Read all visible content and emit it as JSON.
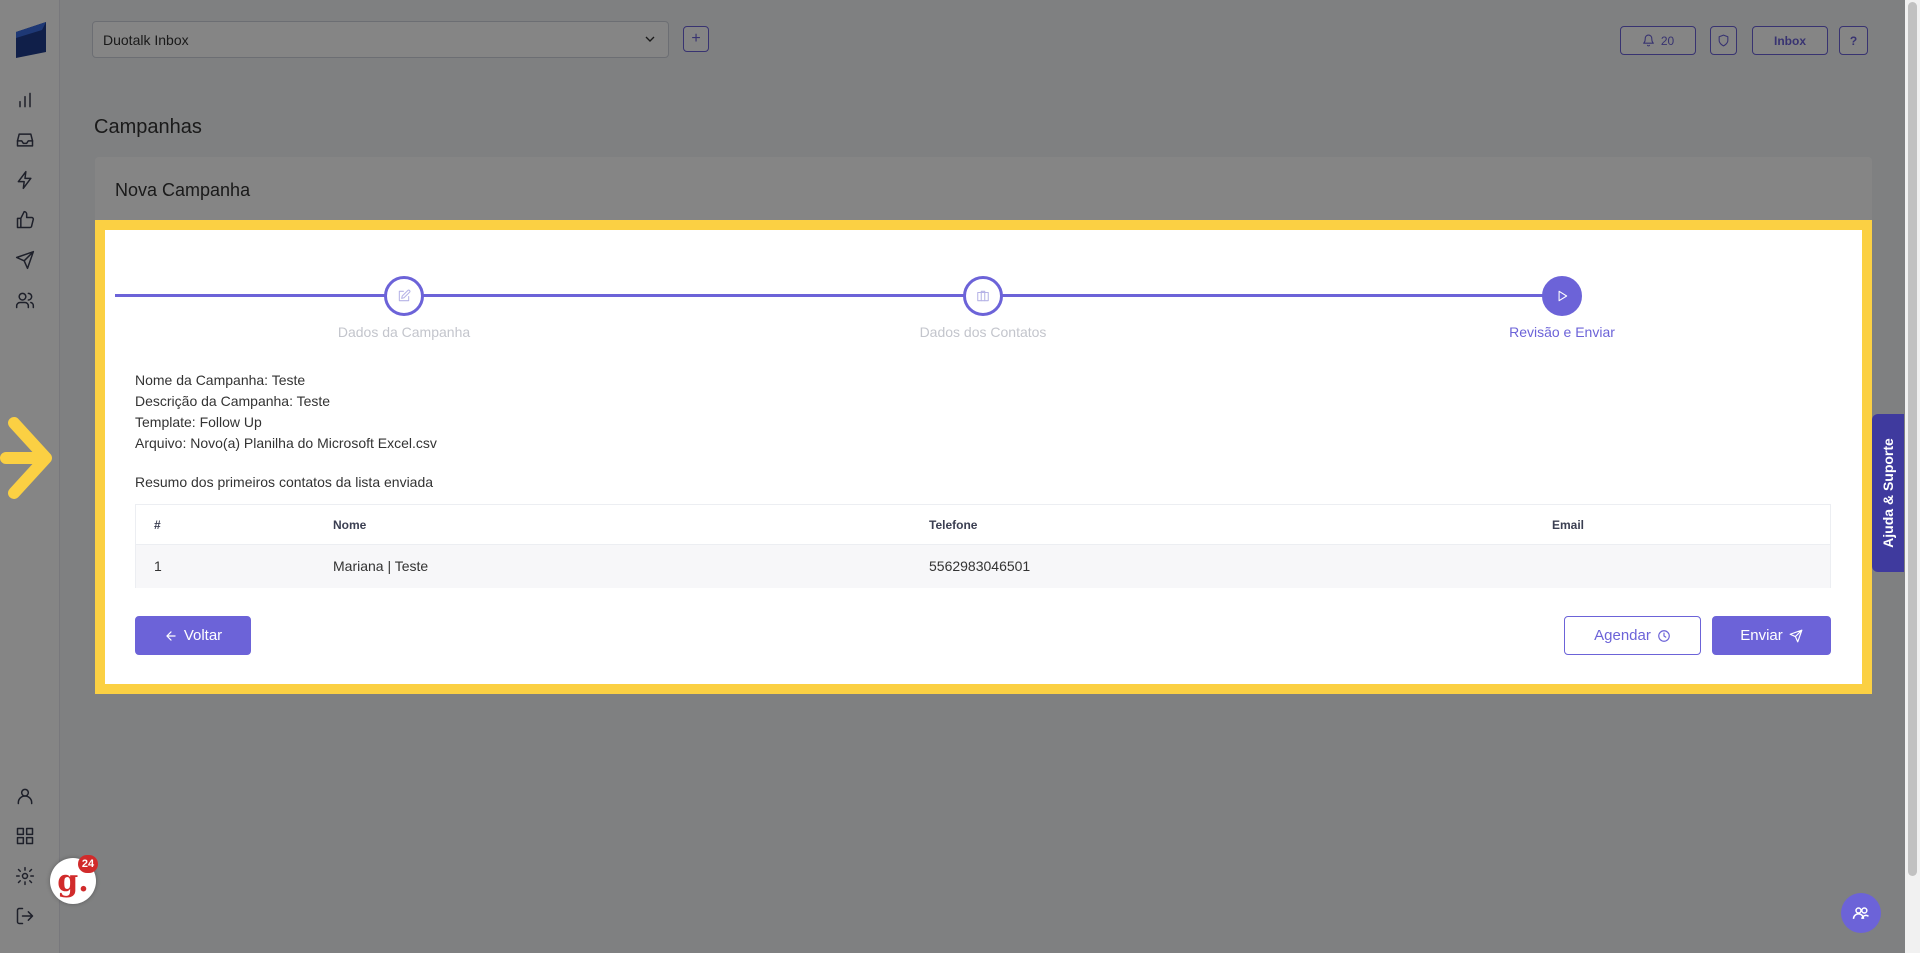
{
  "topbar": {
    "inbox_select": "Duotalk Inbox",
    "notifications_count": "20",
    "inbox_button": "Inbox",
    "help_button": "?",
    "add_button": "+"
  },
  "page": {
    "title": "Campanhas"
  },
  "card": {
    "title": "Nova Campanha"
  },
  "stepper": {
    "steps": [
      {
        "label": "Dados da Campanha",
        "icon": "edit-icon"
      },
      {
        "label": "Dados dos Contatos",
        "icon": "contacts-icon"
      },
      {
        "label": "Revisão e Enviar",
        "icon": "play-icon"
      }
    ],
    "active_step": 3
  },
  "details": {
    "name": "Nome da Campanha: Teste",
    "description": "Descrição da Campanha: Teste",
    "template": "Template: Follow Up",
    "file": "Arquivo: Novo(a) Planilha do Microsoft Excel.csv"
  },
  "summary_title": "Resumo dos primeiros contatos da lista enviada",
  "table": {
    "headers": [
      "#",
      "Nome",
      "Telefone",
      "Email"
    ],
    "rows": [
      [
        "1",
        "Mariana | Teste",
        "5562983046501",
        ""
      ]
    ]
  },
  "buttons": {
    "back": "Voltar",
    "schedule": "Agendar",
    "send": "Enviar"
  },
  "help_tab": "Ajuda & Suporte",
  "g_badge": {
    "letter": "g.",
    "count": "24"
  },
  "colors": {
    "accent": "#6c63d8",
    "highlight": "#fbd043",
    "help_tab": "#3f3a9e"
  }
}
